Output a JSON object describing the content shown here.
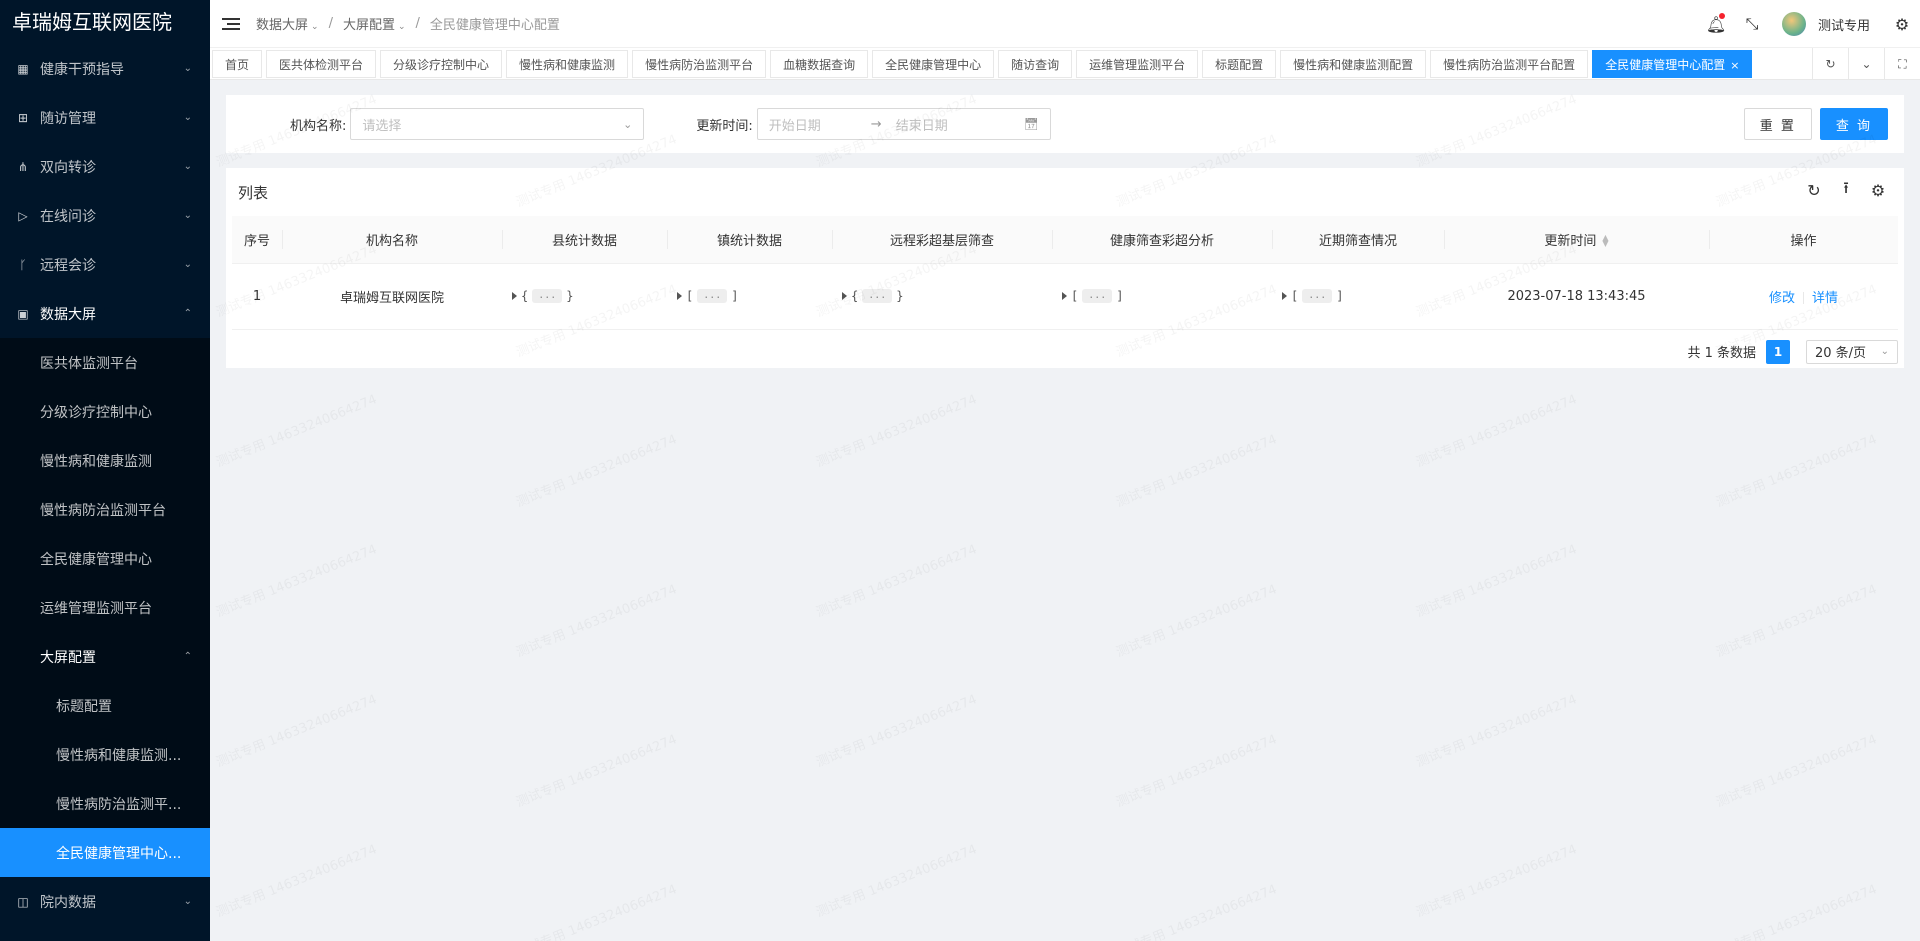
{
  "app": {
    "title": "卓瑞姆互联网医院"
  },
  "sidebar": {
    "items": [
      {
        "label": "健康干预指导",
        "icon": "table-icon"
      },
      {
        "label": "随访管理",
        "icon": "grid-icon"
      },
      {
        "label": "双向转诊",
        "icon": "share-icon"
      },
      {
        "label": "在线问诊",
        "icon": "send-icon"
      },
      {
        "label": "远程会诊",
        "icon": "branch-icon"
      },
      {
        "label": "数据大屏",
        "icon": "dashboard-icon"
      },
      {
        "label": "院内数据",
        "icon": "chart-icon"
      }
    ],
    "dashboard_sub": [
      {
        "label": "医共体监测平台"
      },
      {
        "label": "分级诊疗控制中心"
      },
      {
        "label": "慢性病和健康监测"
      },
      {
        "label": "慢性病防治监测平台"
      },
      {
        "label": "全民健康管理中心"
      },
      {
        "label": "运维管理监测平台"
      },
      {
        "label": "大屏配置"
      }
    ],
    "config_sub": [
      {
        "label": "标题配置"
      },
      {
        "label": "慢性病和健康监测..."
      },
      {
        "label": "慢性病防治监测平..."
      },
      {
        "label": "全民健康管理中心..."
      }
    ]
  },
  "breadcrumb": [
    "数据大屏",
    "大屏配置",
    "全民健康管理中心配置"
  ],
  "header": {
    "username": "测试专用"
  },
  "tabs": [
    {
      "label": "首页"
    },
    {
      "label": "医共体检测平台"
    },
    {
      "label": "分级诊疗控制中心"
    },
    {
      "label": "慢性病和健康监测"
    },
    {
      "label": "慢性病防治监测平台"
    },
    {
      "label": "血糖数据查询"
    },
    {
      "label": "全民健康管理中心"
    },
    {
      "label": "随访查询"
    },
    {
      "label": "运维管理监测平台"
    },
    {
      "label": "标题配置"
    },
    {
      "label": "慢性病和健康监测配置"
    },
    {
      "label": "慢性病防治监测平台配置"
    },
    {
      "label": "全民健康管理中心配置",
      "active": true
    }
  ],
  "search": {
    "org_label": "机构名称:",
    "org_placeholder": "请选择",
    "time_label": "更新时间:",
    "start_placeholder": "开始日期",
    "end_placeholder": "结束日期",
    "reset": "重 置",
    "query": "查 询"
  },
  "table": {
    "title": "列表",
    "columns": [
      "序号",
      "机构名称",
      "县统计数据",
      "镇统计数据",
      "远程彩超基层筛查",
      "健康筛查彩超分析",
      "近期筛查情况",
      "更新时间",
      "操作"
    ],
    "rows": [
      {
        "index": "1",
        "org": "卓瑞姆互联网医院",
        "county_open": "{",
        "county_close": "}",
        "town_open": "[",
        "town_close": "]",
        "remote_open": "{",
        "remote_close": "}",
        "screen_open": "[",
        "screen_close": "]",
        "recent_open": "[",
        "recent_close": "]",
        "ellipsis": "...",
        "updated": "2023-07-18 13:43:45",
        "edit": "修改",
        "detail": "详情"
      }
    ]
  },
  "pagination": {
    "total_text": "共 1 条数据",
    "current": "1",
    "page_size": "20 条/页"
  },
  "watermark": "测试专用 14633240664274",
  "colors": {
    "sidebar_bg": "#001529",
    "primary": "#1890ff",
    "notify_dot": "#f5222d"
  }
}
